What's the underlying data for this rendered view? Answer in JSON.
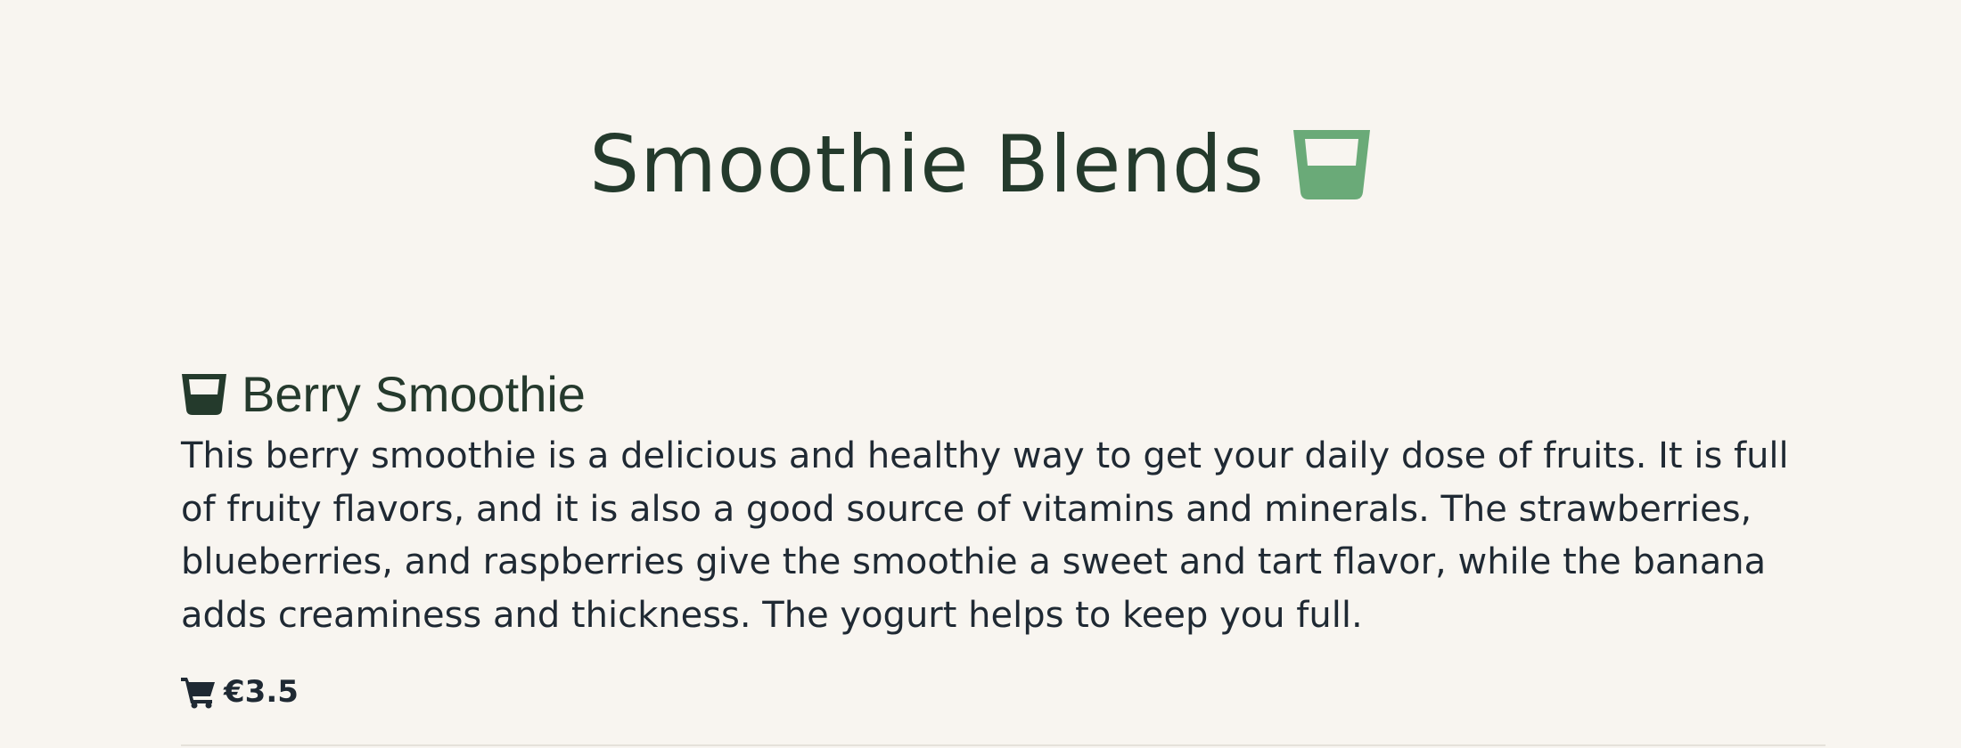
{
  "header": {
    "title": "Smoothie Blends",
    "icon": "glass-icon",
    "icon_color": "#6aaa78"
  },
  "products": [
    {
      "icon": "glass-icon",
      "icon_color": "#243a2c",
      "name": "Berry Smoothie",
      "description": "This berry smoothie is a delicious and healthy way to get your daily dose of fruits. It is full of fruity flavors, and it is also a good source of vitamins and minerals. The strawberries, blueberries, and raspberries give the smoothie a sweet and tart flavor, while the banana adds creaminess and thickness. The yogurt helps to keep you full.",
      "price": "€3.5",
      "price_icon": "cart-icon"
    }
  ],
  "colors": {
    "background": "#f8f5f0",
    "text": "#243a2c",
    "accent": "#6aaa78"
  }
}
